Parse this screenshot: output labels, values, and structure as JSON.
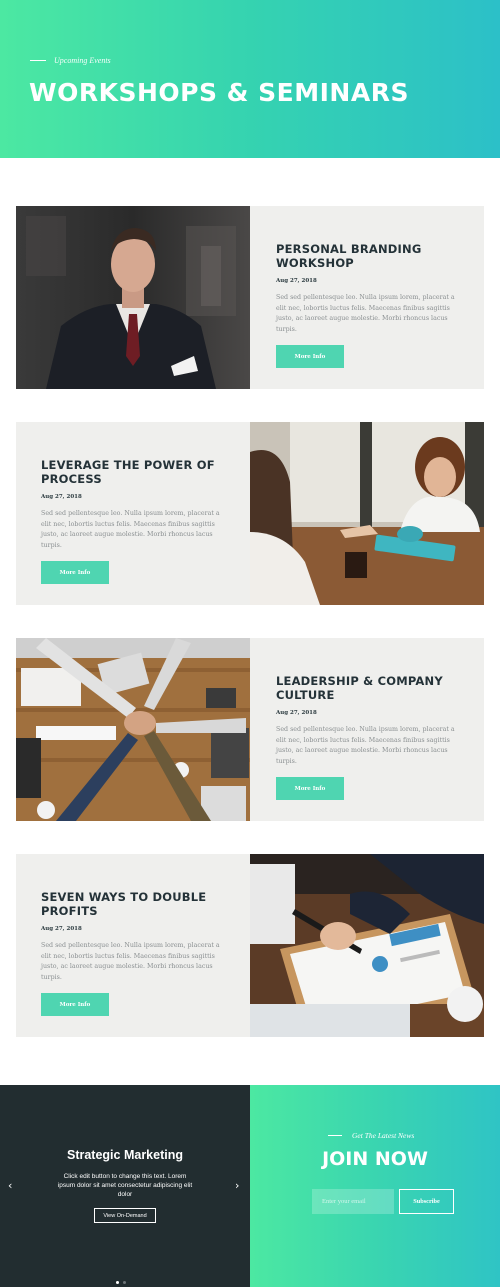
{
  "hero": {
    "eyebrow": "Upcoming Events",
    "title": "WORKSHOPS & SEMINARS"
  },
  "events": [
    {
      "title": "PERSONAL BRANDING WORKSHOP",
      "date": "Aug 27, 2018",
      "description": "Sed sed pellentesque leo. Nulla ipsum lorem, placerat a elit nec, lobortis luctus felis. Maecenas finibus sagittis justo, ac laoreet augue molestie. Morbi rhoncus lacus turpis.",
      "button": "More Info",
      "image": "businessman-portrait-photo"
    },
    {
      "title": "LEVERAGE THE POWER OF PROCESS",
      "date": "Aug 27, 2018",
      "description": "Sed sed pellentesque leo. Nulla ipsum lorem, placerat a elit nec, lobortis luctus felis. Maecenas finibus sagittis justo, ac laoreet augue molestie. Morbi rhoncus lacus turpis.",
      "button": "More Info",
      "image": "cafe-meeting-photo"
    },
    {
      "title": "LEADERSHIP & COMPANY CULTURE",
      "date": "Aug 27, 2018",
      "description": "Sed sed pellentesque leo. Nulla ipsum lorem, placerat a elit nec, lobortis luctus felis. Maecenas finibus sagittis justo, ac laoreet augue molestie. Morbi rhoncus lacus turpis.",
      "button": "More Info",
      "image": "team-hands-together-photo"
    },
    {
      "title": "SEVEN WAYS TO DOUBLE PROFITS",
      "date": "Aug 27, 2018",
      "description": "Sed sed pellentesque leo. Nulla ipsum lorem, placerat a elit nec, lobortis luctus felis. Maecenas finibus sagittis justo, ac laoreet augue molestie. Morbi rhoncus lacus turpis.",
      "button": "More Info",
      "image": "financial-report-signing-photo"
    }
  ],
  "slider": {
    "title": "Strategic Marketing",
    "text": "Click edit button to change this text. Lorem ipsum dolor sit amet consectetur adipiscing elit dolor",
    "button": "View On-Demand",
    "prev_icon": "chevron-left-icon",
    "next_icon": "chevron-right-icon",
    "prev_glyph": "‹",
    "next_glyph": "›"
  },
  "newsletter": {
    "eyebrow": "Get The Latest News",
    "title": "JOIN NOW",
    "email_placeholder": "Enter your email",
    "button": "Subscribe"
  },
  "colors": {
    "accent": "#4fd5b1",
    "gradient_start": "#4ce8a2",
    "gradient_end": "#2cc0c8",
    "dark": "#222d30",
    "card_bg": "#efefed"
  }
}
